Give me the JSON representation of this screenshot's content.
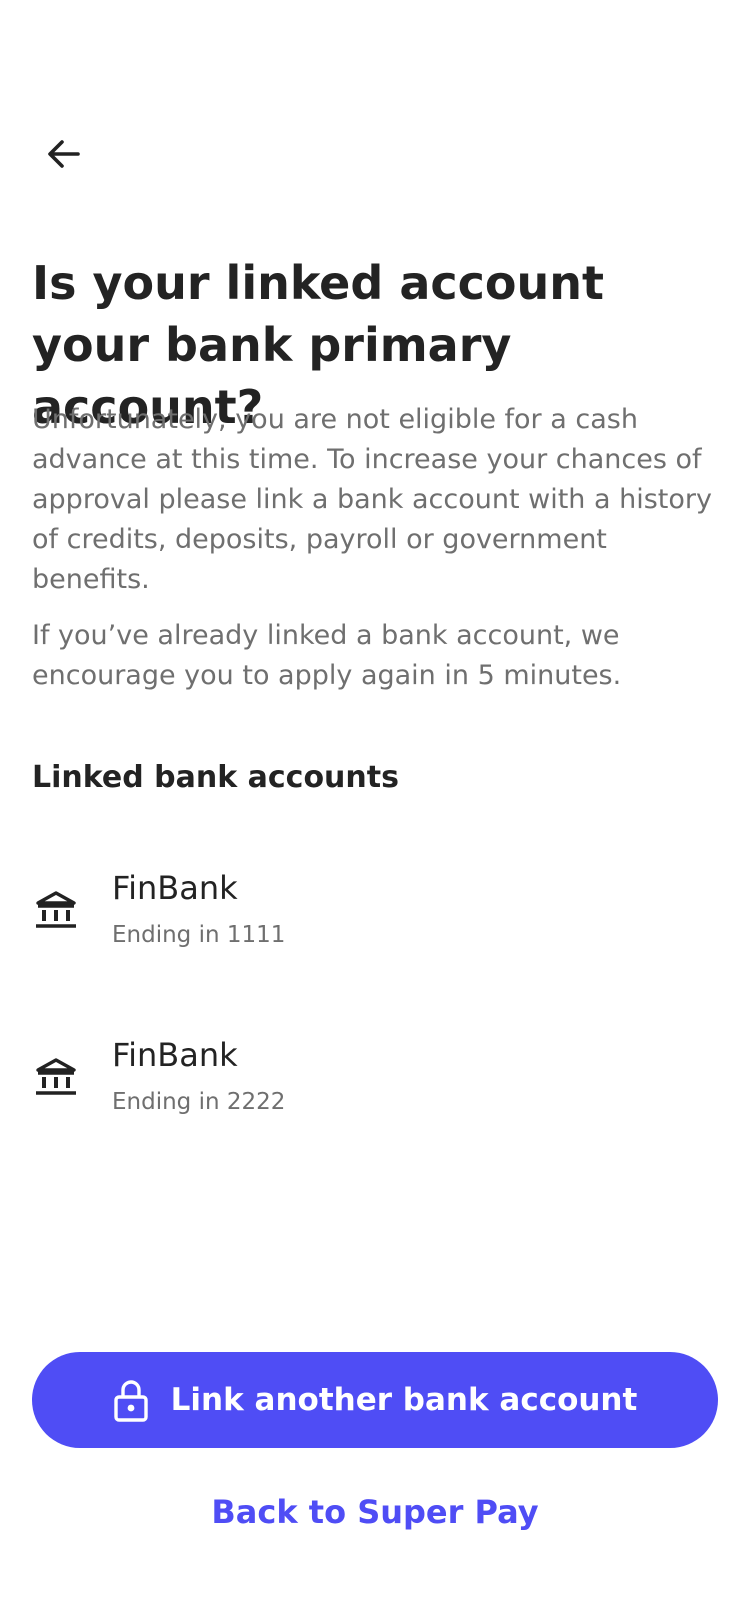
{
  "header": {
    "back_icon": "arrow-left-icon"
  },
  "main": {
    "title": "Is your linked account your bank primary account?",
    "description_1": "Unfortunately, you are not eligible for a cash advance at this time. To increase your chances of approval please link a bank account with a history of credits, deposits, payroll or government benefits.",
    "description_2": "If you’ve already linked a bank account, we encourage you to apply again in 5 minutes."
  },
  "linked_accounts": {
    "heading": "Linked bank accounts",
    "icon": "bank-icon",
    "items": [
      {
        "name": "FinBank",
        "ending": "Ending in 1111"
      },
      {
        "name": "FinBank",
        "ending": "Ending in 2222"
      }
    ]
  },
  "actions": {
    "link_button_label": "Link another bank account",
    "link_button_icon": "lock-icon",
    "back_link_label": "Back to Super Pay"
  },
  "colors": {
    "accent": "#4f4df5",
    "text_primary": "#232323",
    "text_secondary": "#6f6f6f",
    "background": "#ffffff"
  }
}
